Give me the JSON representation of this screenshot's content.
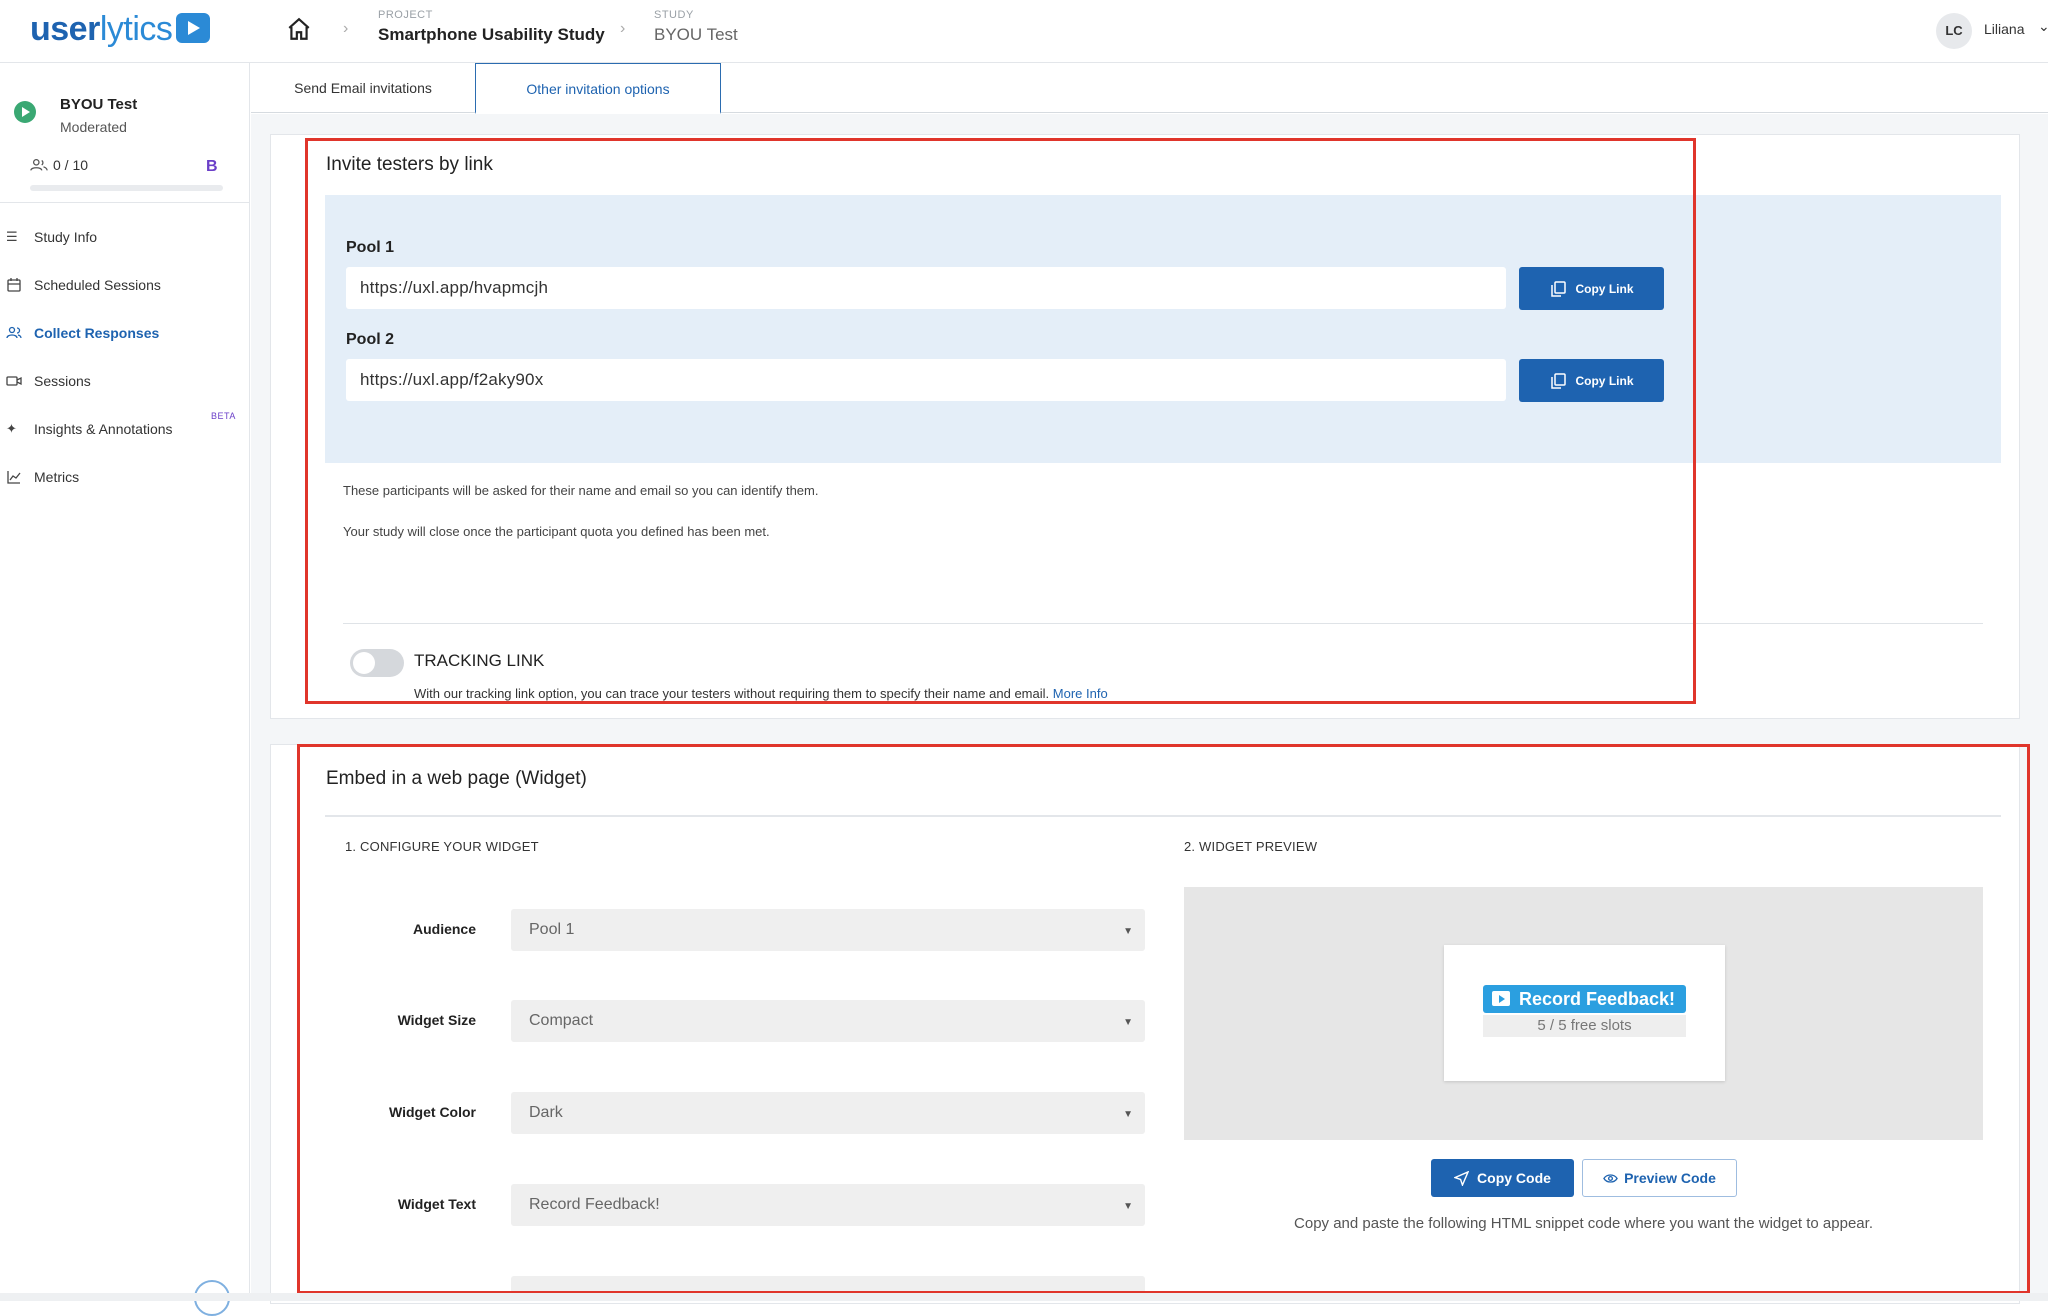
{
  "header": {
    "logo_text_bold": "user",
    "logo_text_light": "lytics",
    "project_label": "PROJECT",
    "project_name": "Smartphone Usability Study",
    "study_label": "STUDY",
    "study_name": "BYOU Test",
    "avatar_initials": "LC",
    "user_name": "Liliana"
  },
  "sidebar": {
    "study_name": "BYOU Test",
    "study_type": "Moderated",
    "quota": "0 / 10",
    "quota_fraction": 0,
    "plan_badge": "B",
    "items": [
      {
        "label": "Study Info",
        "icon": "list-icon"
      },
      {
        "label": "Scheduled Sessions",
        "icon": "calendar-icon"
      },
      {
        "label": "Collect Responses",
        "icon": "users-icon",
        "active": true
      },
      {
        "label": "Sessions",
        "icon": "video-icon"
      },
      {
        "label": "Insights & Annotations",
        "icon": "sparkle-icon",
        "badge": "BETA"
      },
      {
        "label": "Metrics",
        "icon": "chart-icon"
      }
    ]
  },
  "tabs": [
    {
      "label": "Send Email invitations"
    },
    {
      "label": "Other invitation options",
      "active": true
    }
  ],
  "invite": {
    "title": "Invite testers by link",
    "pools": [
      {
        "label": "Pool 1",
        "url": "https://uxl.app/hvapmcjh",
        "button": "Copy Link"
      },
      {
        "label": "Pool 2",
        "url": "https://uxl.app/f2aky90x",
        "button": "Copy Link"
      }
    ],
    "note1": "These participants will be asked for their name and email so you can identify them.",
    "note2": "Your study will close once the participant quota you defined has been met.",
    "tracking_title": "TRACKING LINK",
    "tracking_desc": "With our tracking link option, you can trace your testers without requiring them to specify their name and email.",
    "tracking_more": "More Info",
    "tracking_enabled": false
  },
  "widget": {
    "title": "Embed in a web page (Widget)",
    "configure_label": "1. CONFIGURE YOUR WIDGET",
    "preview_label": "2. WIDGET PREVIEW",
    "fields": [
      {
        "label": "Audience",
        "value": "Pool 1"
      },
      {
        "label": "Widget Size",
        "value": "Compact"
      },
      {
        "label": "Widget Color",
        "value": "Dark"
      },
      {
        "label": "Widget Text",
        "value": "Record Feedback!"
      }
    ],
    "preview_button": "Record Feedback!",
    "preview_slots": "5 / 5 free slots",
    "copy_code": "Copy Code",
    "preview_code": "Preview Code",
    "snippet_note": "Copy and paste the following HTML snippet code where you want the widget to appear."
  },
  "colors": {
    "accent": "#1e63b0",
    "highlight": "#e0352b",
    "link_box": "#e4eef8",
    "widget_button": "#2b9fe0"
  }
}
